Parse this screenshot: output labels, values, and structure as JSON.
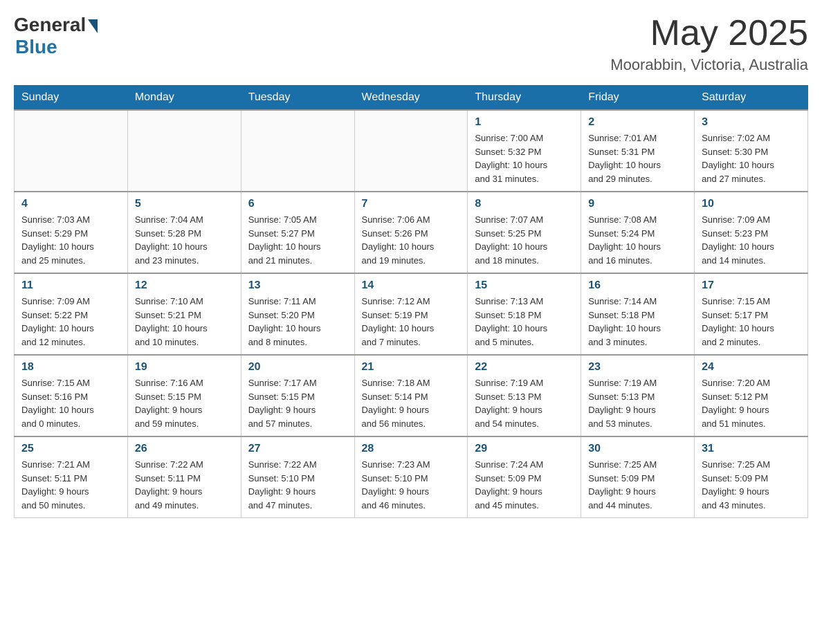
{
  "header": {
    "logo_general": "General",
    "logo_blue": "Blue",
    "month_title": "May 2025",
    "location": "Moorabbin, Victoria, Australia"
  },
  "days_of_week": [
    "Sunday",
    "Monday",
    "Tuesday",
    "Wednesday",
    "Thursday",
    "Friday",
    "Saturday"
  ],
  "weeks": [
    [
      {
        "day": "",
        "info": ""
      },
      {
        "day": "",
        "info": ""
      },
      {
        "day": "",
        "info": ""
      },
      {
        "day": "",
        "info": ""
      },
      {
        "day": "1",
        "info": "Sunrise: 7:00 AM\nSunset: 5:32 PM\nDaylight: 10 hours\nand 31 minutes."
      },
      {
        "day": "2",
        "info": "Sunrise: 7:01 AM\nSunset: 5:31 PM\nDaylight: 10 hours\nand 29 minutes."
      },
      {
        "day": "3",
        "info": "Sunrise: 7:02 AM\nSunset: 5:30 PM\nDaylight: 10 hours\nand 27 minutes."
      }
    ],
    [
      {
        "day": "4",
        "info": "Sunrise: 7:03 AM\nSunset: 5:29 PM\nDaylight: 10 hours\nand 25 minutes."
      },
      {
        "day": "5",
        "info": "Sunrise: 7:04 AM\nSunset: 5:28 PM\nDaylight: 10 hours\nand 23 minutes."
      },
      {
        "day": "6",
        "info": "Sunrise: 7:05 AM\nSunset: 5:27 PM\nDaylight: 10 hours\nand 21 minutes."
      },
      {
        "day": "7",
        "info": "Sunrise: 7:06 AM\nSunset: 5:26 PM\nDaylight: 10 hours\nand 19 minutes."
      },
      {
        "day": "8",
        "info": "Sunrise: 7:07 AM\nSunset: 5:25 PM\nDaylight: 10 hours\nand 18 minutes."
      },
      {
        "day": "9",
        "info": "Sunrise: 7:08 AM\nSunset: 5:24 PM\nDaylight: 10 hours\nand 16 minutes."
      },
      {
        "day": "10",
        "info": "Sunrise: 7:09 AM\nSunset: 5:23 PM\nDaylight: 10 hours\nand 14 minutes."
      }
    ],
    [
      {
        "day": "11",
        "info": "Sunrise: 7:09 AM\nSunset: 5:22 PM\nDaylight: 10 hours\nand 12 minutes."
      },
      {
        "day": "12",
        "info": "Sunrise: 7:10 AM\nSunset: 5:21 PM\nDaylight: 10 hours\nand 10 minutes."
      },
      {
        "day": "13",
        "info": "Sunrise: 7:11 AM\nSunset: 5:20 PM\nDaylight: 10 hours\nand 8 minutes."
      },
      {
        "day": "14",
        "info": "Sunrise: 7:12 AM\nSunset: 5:19 PM\nDaylight: 10 hours\nand 7 minutes."
      },
      {
        "day": "15",
        "info": "Sunrise: 7:13 AM\nSunset: 5:18 PM\nDaylight: 10 hours\nand 5 minutes."
      },
      {
        "day": "16",
        "info": "Sunrise: 7:14 AM\nSunset: 5:18 PM\nDaylight: 10 hours\nand 3 minutes."
      },
      {
        "day": "17",
        "info": "Sunrise: 7:15 AM\nSunset: 5:17 PM\nDaylight: 10 hours\nand 2 minutes."
      }
    ],
    [
      {
        "day": "18",
        "info": "Sunrise: 7:15 AM\nSunset: 5:16 PM\nDaylight: 10 hours\nand 0 minutes."
      },
      {
        "day": "19",
        "info": "Sunrise: 7:16 AM\nSunset: 5:15 PM\nDaylight: 9 hours\nand 59 minutes."
      },
      {
        "day": "20",
        "info": "Sunrise: 7:17 AM\nSunset: 5:15 PM\nDaylight: 9 hours\nand 57 minutes."
      },
      {
        "day": "21",
        "info": "Sunrise: 7:18 AM\nSunset: 5:14 PM\nDaylight: 9 hours\nand 56 minutes."
      },
      {
        "day": "22",
        "info": "Sunrise: 7:19 AM\nSunset: 5:13 PM\nDaylight: 9 hours\nand 54 minutes."
      },
      {
        "day": "23",
        "info": "Sunrise: 7:19 AM\nSunset: 5:13 PM\nDaylight: 9 hours\nand 53 minutes."
      },
      {
        "day": "24",
        "info": "Sunrise: 7:20 AM\nSunset: 5:12 PM\nDaylight: 9 hours\nand 51 minutes."
      }
    ],
    [
      {
        "day": "25",
        "info": "Sunrise: 7:21 AM\nSunset: 5:11 PM\nDaylight: 9 hours\nand 50 minutes."
      },
      {
        "day": "26",
        "info": "Sunrise: 7:22 AM\nSunset: 5:11 PM\nDaylight: 9 hours\nand 49 minutes."
      },
      {
        "day": "27",
        "info": "Sunrise: 7:22 AM\nSunset: 5:10 PM\nDaylight: 9 hours\nand 47 minutes."
      },
      {
        "day": "28",
        "info": "Sunrise: 7:23 AM\nSunset: 5:10 PM\nDaylight: 9 hours\nand 46 minutes."
      },
      {
        "day": "29",
        "info": "Sunrise: 7:24 AM\nSunset: 5:09 PM\nDaylight: 9 hours\nand 45 minutes."
      },
      {
        "day": "30",
        "info": "Sunrise: 7:25 AM\nSunset: 5:09 PM\nDaylight: 9 hours\nand 44 minutes."
      },
      {
        "day": "31",
        "info": "Sunrise: 7:25 AM\nSunset: 5:09 PM\nDaylight: 9 hours\nand 43 minutes."
      }
    ]
  ]
}
